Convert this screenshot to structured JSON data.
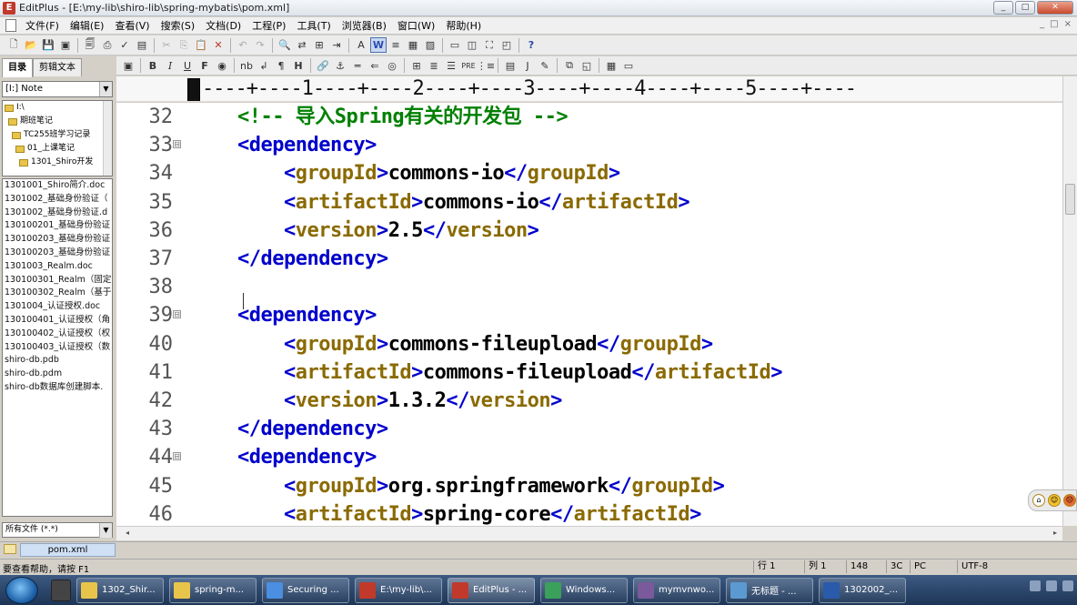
{
  "window": {
    "title": "EditPlus - [E:\\my-lib\\shiro-lib\\spring-mybatis\\pom.xml]",
    "app_icon_letter": "E",
    "buttons": {
      "minimize": "_",
      "maximize": "□",
      "close": "✕"
    }
  },
  "menu": [
    "文件(F)",
    "编辑(E)",
    "查看(V)",
    "搜索(S)",
    "文档(D)",
    "工程(P)",
    "工具(T)",
    "浏览器(B)",
    "窗口(W)",
    "帮助(H)"
  ],
  "mdi_buttons": [
    "_",
    "□",
    "×"
  ],
  "left_panel": {
    "tabs": [
      "目录",
      "剪辑文本"
    ],
    "drive": "[I:] Note",
    "tree": [
      "I:\\",
      "期班笔记",
      "TC255班学习记录",
      "01_上课笔记",
      "1301_Shiro开发"
    ],
    "files": [
      "1301001_Shiro简介.doc",
      "1301002_基础身份验证（",
      "1301002_基础身份验证.d",
      "130100201_基础身份验证",
      "130100203_基础身份验证",
      "130100203_基础身份验证",
      "1301003_Realm.doc",
      "130100301_Realm（固定",
      "130100302_Realm（基于",
      "1301004_认证授权.doc",
      "130100401_认证授权（角",
      "130100402_认证授权（权",
      "130100403_认证授权（数",
      "shiro-db.pdb",
      "shiro-db.pdm",
      "shiro-db数据库创建脚本."
    ],
    "filter": "所有文件 (*.*)"
  },
  "document_tab": "pom.xml",
  "ruler": "----+----1----+----2----+----3----+----4----+----5----+----",
  "editor": {
    "lines": [
      {
        "num": "32",
        "fold": "",
        "indent": "    ",
        "parts": [
          {
            "t": "cmt",
            "s": "<!-- 导入Spring有关的开发包 -->"
          }
        ]
      },
      {
        "num": "33",
        "fold": "⊟",
        "indent": "    ",
        "parts": [
          {
            "t": "tag",
            "s": "<dependency>"
          }
        ]
      },
      {
        "num": "34",
        "fold": "",
        "indent": "        ",
        "parts": [
          {
            "t": "tag",
            "s": "<"
          },
          {
            "t": "attr",
            "s": "groupId"
          },
          {
            "t": "tag",
            "s": ">"
          },
          {
            "t": "txt",
            "s": "commons-io"
          },
          {
            "t": "tag",
            "s": "</"
          },
          {
            "t": "attr",
            "s": "groupId"
          },
          {
            "t": "tag",
            "s": ">"
          }
        ]
      },
      {
        "num": "35",
        "fold": "",
        "indent": "        ",
        "parts": [
          {
            "t": "tag",
            "s": "<"
          },
          {
            "t": "attr",
            "s": "artifactId"
          },
          {
            "t": "tag",
            "s": ">"
          },
          {
            "t": "txt",
            "s": "commons-io"
          },
          {
            "t": "tag",
            "s": "</"
          },
          {
            "t": "attr",
            "s": "artifactId"
          },
          {
            "t": "tag",
            "s": ">"
          }
        ]
      },
      {
        "num": "36",
        "fold": "",
        "indent": "        ",
        "parts": [
          {
            "t": "tag",
            "s": "<"
          },
          {
            "t": "attr",
            "s": "version"
          },
          {
            "t": "tag",
            "s": ">"
          },
          {
            "t": "txt",
            "s": "2.5"
          },
          {
            "t": "tag",
            "s": "</"
          },
          {
            "t": "attr",
            "s": "version"
          },
          {
            "t": "tag",
            "s": ">"
          }
        ]
      },
      {
        "num": "37",
        "fold": "",
        "indent": "    ",
        "parts": [
          {
            "t": "tag",
            "s": "</dependency>"
          }
        ]
      },
      {
        "num": "38",
        "fold": "",
        "indent": "",
        "parts": []
      },
      {
        "num": "39",
        "fold": "⊟",
        "indent": "    ",
        "parts": [
          {
            "t": "tag",
            "s": "<dependency>"
          }
        ]
      },
      {
        "num": "40",
        "fold": "",
        "indent": "        ",
        "parts": [
          {
            "t": "tag",
            "s": "<"
          },
          {
            "t": "attr",
            "s": "groupId"
          },
          {
            "t": "tag",
            "s": ">"
          },
          {
            "t": "txt",
            "s": "commons-fileupload"
          },
          {
            "t": "tag",
            "s": "</"
          },
          {
            "t": "attr",
            "s": "groupId"
          },
          {
            "t": "tag",
            "s": ">"
          }
        ]
      },
      {
        "num": "41",
        "fold": "",
        "indent": "        ",
        "parts": [
          {
            "t": "tag",
            "s": "<"
          },
          {
            "t": "attr",
            "s": "artifactId"
          },
          {
            "t": "tag",
            "s": ">"
          },
          {
            "t": "txt",
            "s": "commons-fileupload"
          },
          {
            "t": "tag",
            "s": "</"
          },
          {
            "t": "attr",
            "s": "artifactId"
          },
          {
            "t": "tag",
            "s": ">"
          }
        ]
      },
      {
        "num": "42",
        "fold": "",
        "indent": "        ",
        "parts": [
          {
            "t": "tag",
            "s": "<"
          },
          {
            "t": "attr",
            "s": "version"
          },
          {
            "t": "tag",
            "s": ">"
          },
          {
            "t": "txt",
            "s": "1.3.2"
          },
          {
            "t": "tag",
            "s": "</"
          },
          {
            "t": "attr",
            "s": "version"
          },
          {
            "t": "tag",
            "s": ">"
          }
        ]
      },
      {
        "num": "43",
        "fold": "",
        "indent": "    ",
        "parts": [
          {
            "t": "tag",
            "s": "</dependency>"
          }
        ]
      },
      {
        "num": "44",
        "fold": "⊟",
        "indent": "    ",
        "parts": [
          {
            "t": "tag",
            "s": "<dependency>"
          }
        ]
      },
      {
        "num": "45",
        "fold": "",
        "indent": "        ",
        "parts": [
          {
            "t": "tag",
            "s": "<"
          },
          {
            "t": "attr",
            "s": "groupId"
          },
          {
            "t": "tag",
            "s": ">"
          },
          {
            "t": "txt",
            "s": "org.springframework"
          },
          {
            "t": "tag",
            "s": "</"
          },
          {
            "t": "attr",
            "s": "groupId"
          },
          {
            "t": "tag",
            "s": ">"
          }
        ]
      },
      {
        "num": "46",
        "fold": "",
        "indent": "        ",
        "parts": [
          {
            "t": "tag",
            "s": "<"
          },
          {
            "t": "attr",
            "s": "artifactId"
          },
          {
            "t": "tag",
            "s": ">"
          },
          {
            "t": "txt",
            "s": "spring-core"
          },
          {
            "t": "tag",
            "s": "</"
          },
          {
            "t": "attr",
            "s": "artifactId"
          },
          {
            "t": "tag",
            "s": ">"
          }
        ]
      }
    ]
  },
  "status": {
    "help": "要查看帮助，请按 F1",
    "line": "行 1",
    "col": "列 1",
    "chars": "148",
    "hex": "3C",
    "mode": "PC",
    "encoding": "UTF-8"
  },
  "taskbar": {
    "tasks": [
      {
        "label": "1302_Shir...",
        "color": "#e8c54a"
      },
      {
        "label": "spring-m...",
        "color": "#e8c54a"
      },
      {
        "label": "Securing ...",
        "color": "#4a8fe0"
      },
      {
        "label": "E:\\my-lib\\...",
        "color": "#c0392b"
      },
      {
        "label": "EditPlus - ...",
        "color": "#c0392b"
      },
      {
        "label": "Windows...",
        "color": "#3aa05a"
      },
      {
        "label": "mymvnwo...",
        "color": "#7a5a9a"
      },
      {
        "label": "无标题 - ...",
        "color": "#5a9ad0"
      },
      {
        "label": "1302002_...",
        "color": "#2a5aaa"
      }
    ]
  },
  "colors": {
    "tag": "#0000cc",
    "attr": "#8a6a00",
    "comment": "#008000",
    "text": "#000000"
  }
}
